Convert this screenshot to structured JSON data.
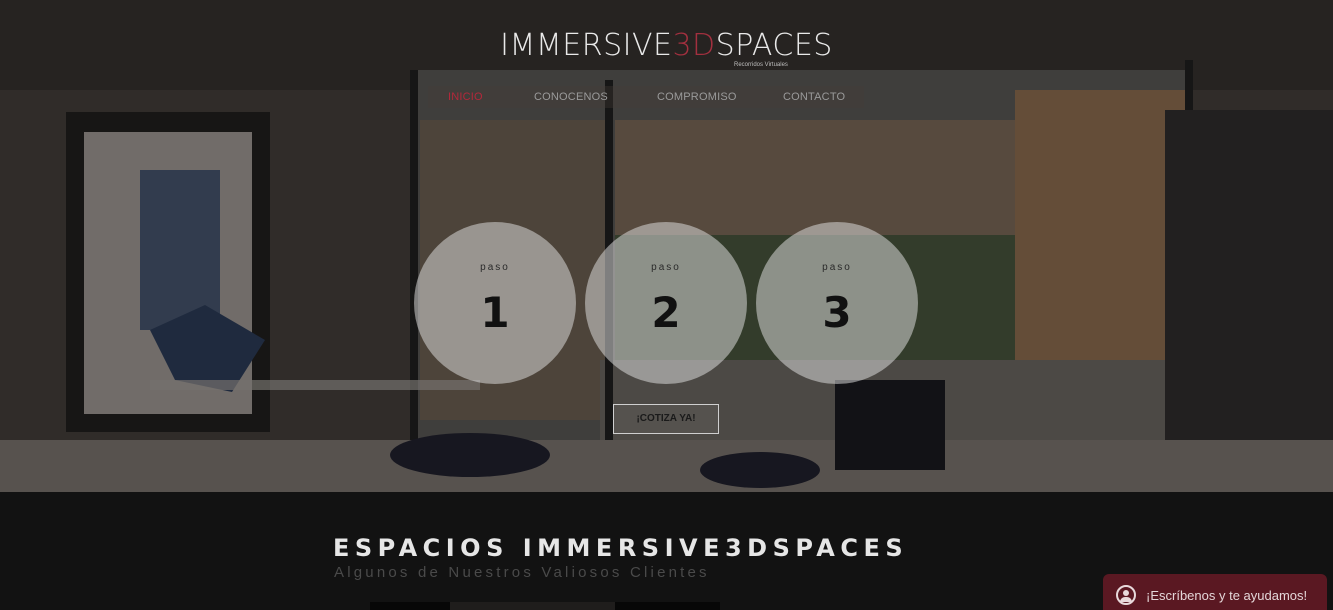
{
  "brand": {
    "logo_left": "IMMERSIVE",
    "logo_accent": "3D",
    "logo_right": "SPACES",
    "tagline": "Recorridos Virtuales"
  },
  "nav": {
    "items": [
      "INICIO",
      "CONOCENOS",
      "COMPROMISO",
      "CONTACTO"
    ],
    "active": "INICIO"
  },
  "steps": [
    {
      "label": "paso",
      "number": "1"
    },
    {
      "label": "paso",
      "number": "2"
    },
    {
      "label": "paso",
      "number": "3"
    }
  ],
  "cta_label": "¡COTIZA YA!",
  "section": {
    "title": "ESPACIOS IMMERSIVE3DSPACES",
    "subtitle": "Algunos de Nuestros Valiosos Clientes"
  },
  "chat": {
    "label": "¡Escríbenos y te ayudamos!",
    "icon": "user-icon"
  },
  "colors": {
    "accent": "#b3283a",
    "chat_bg": "#5a1822",
    "background": "#121212"
  }
}
